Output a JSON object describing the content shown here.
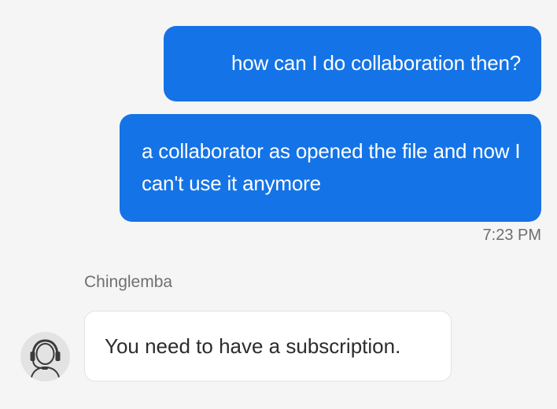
{
  "conversation": {
    "messages": [
      {
        "direction": "outgoing",
        "text": "how can I do collaboration then?"
      },
      {
        "direction": "outgoing",
        "text": "a collaborator as opened the file and now I can't use it anymore"
      }
    ],
    "outgoing_timestamp": "7:23 PM",
    "agent": {
      "name": "Chinglemba",
      "avatar_icon": "headset-agent-icon",
      "message": "You need to have a subscription."
    }
  },
  "colors": {
    "outgoing_bubble": "#1473e6",
    "background": "#f5f5f5",
    "incoming_bubble": "#ffffff"
  }
}
